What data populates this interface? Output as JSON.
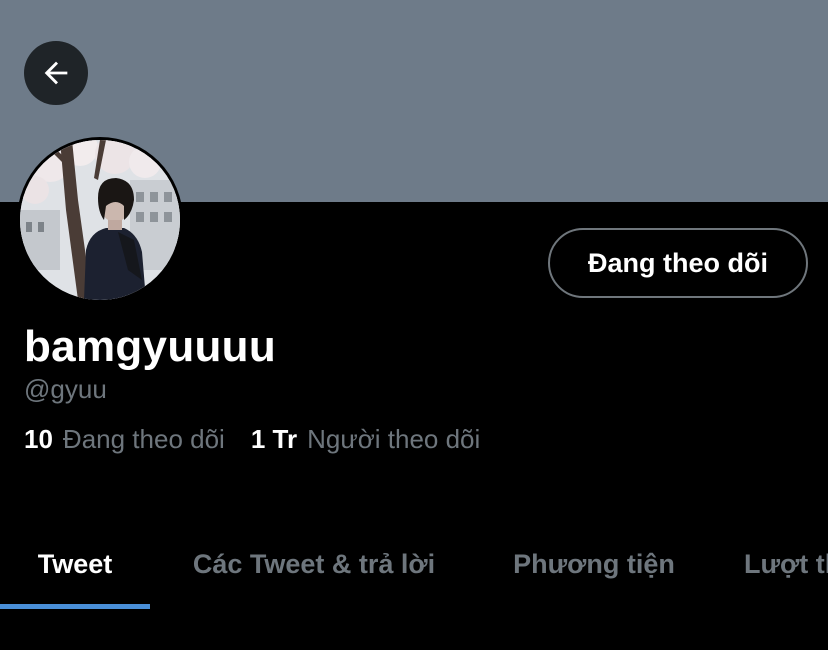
{
  "profile": {
    "display_name": "bamgyuuuu",
    "handle": "@gyuu",
    "follow_button_label": "Đang theo dõi",
    "stats": {
      "following_count": "10",
      "following_label": "Đang theo dõi",
      "followers_count": "1 Tr",
      "followers_label": "Người theo dõi"
    }
  },
  "tabs": [
    "Tweet",
    "Các Tweet & trả lời",
    "Phương tiện",
    "Lượt thích"
  ],
  "active_tab": "Tweet",
  "icons": {
    "back": "arrow-left-icon"
  },
  "colors": {
    "banner": "#6e7b89",
    "background": "#000000",
    "accent": "#4a8fd8",
    "muted_text": "#6e767d"
  }
}
